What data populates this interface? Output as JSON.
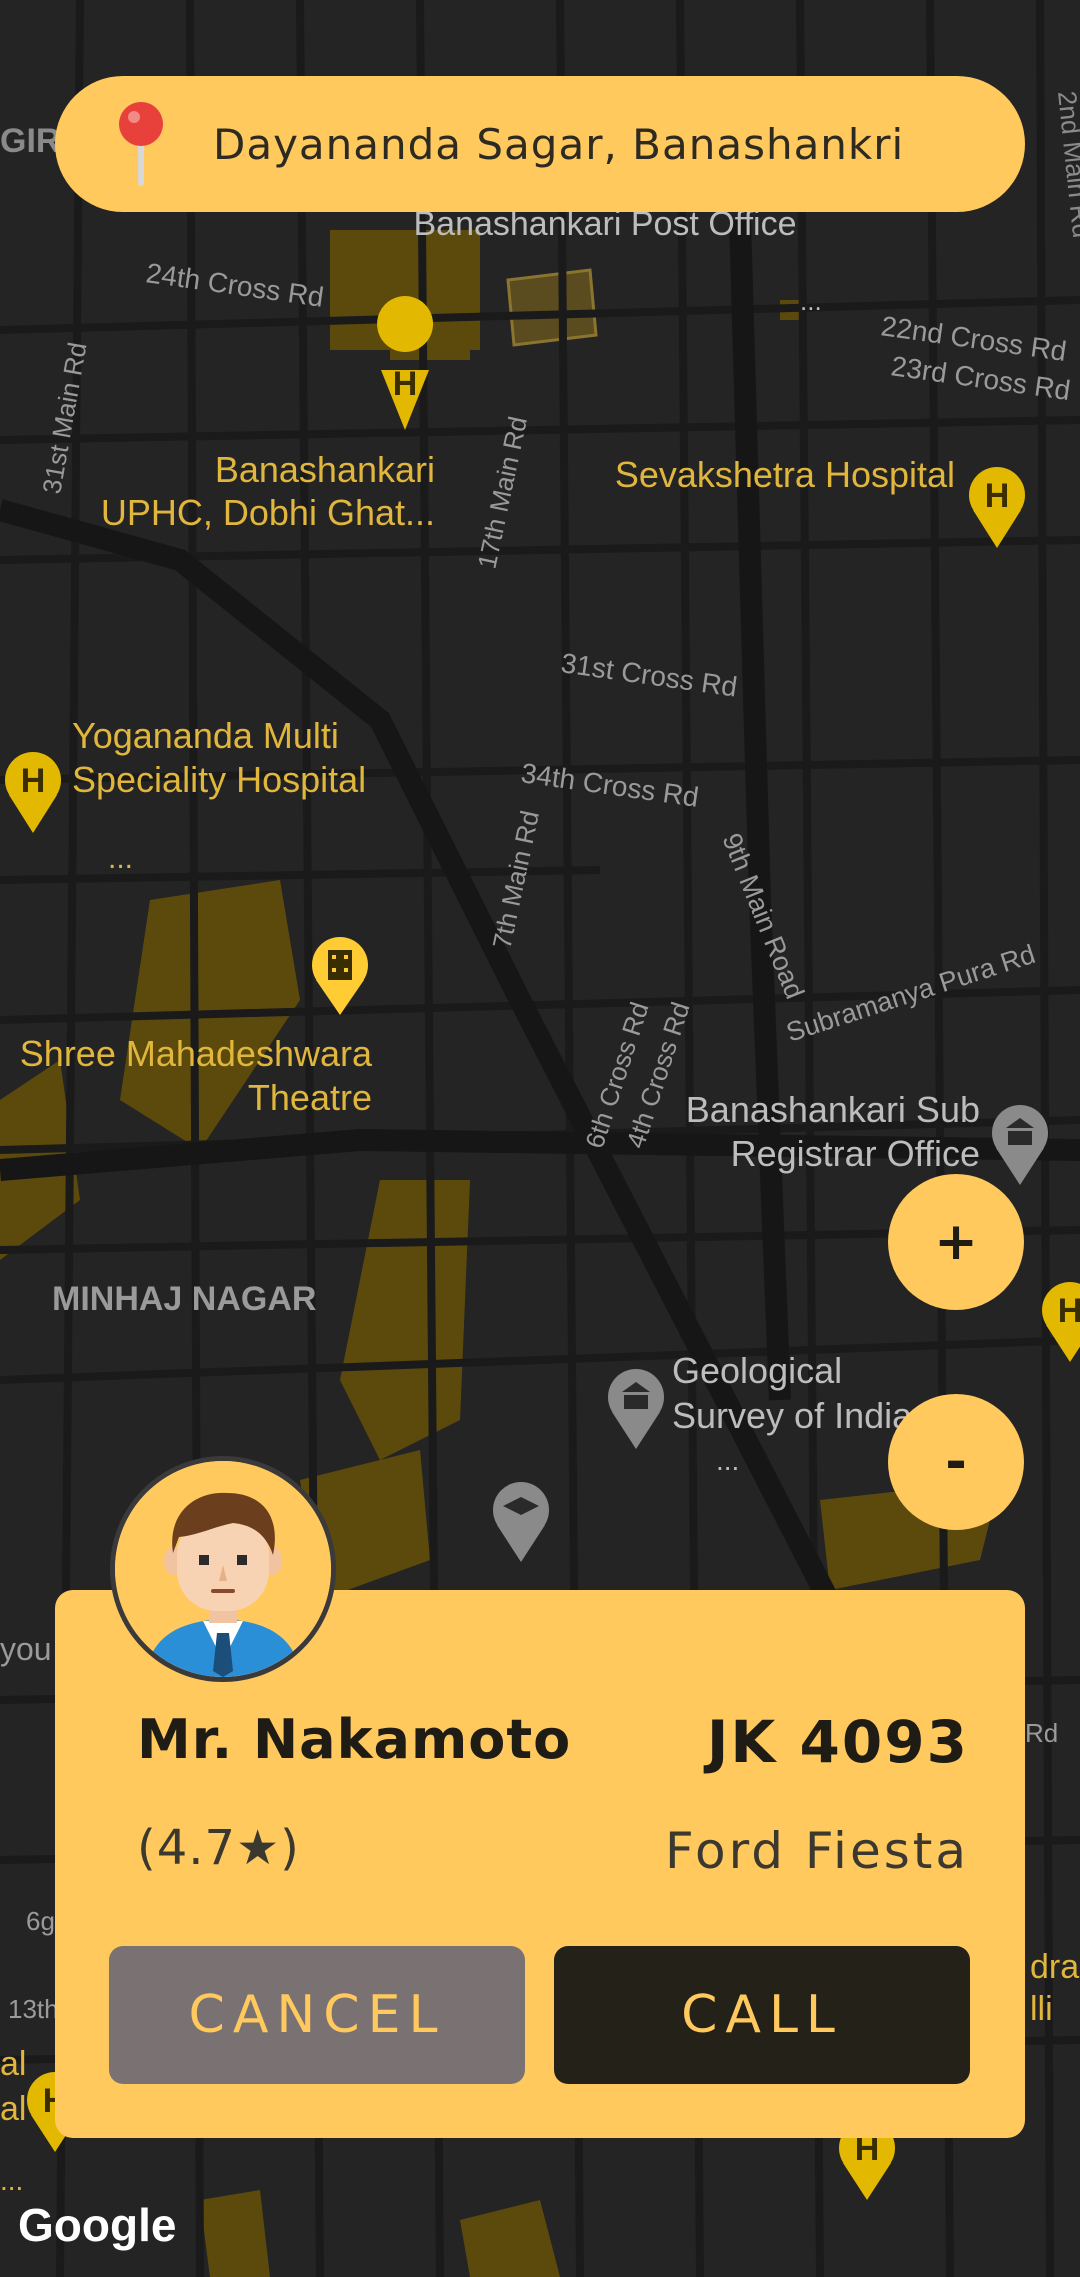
{
  "colors": {
    "accent": "#FFC95E",
    "map_bg": "#242424",
    "dark_button": "#242119",
    "cancel_button": "#7a7272"
  },
  "search": {
    "location": "Dayananda Sagar, Banashankri",
    "icon": "map-pin-icon"
  },
  "map": {
    "labels": {
      "post_office": "Banashankari Post Office",
      "cross24": "24th Cross Rd",
      "cross22": "22nd Cross Rd",
      "cross23": "23rd Cross Rd",
      "main31": "31st Main Rd",
      "main17": "17th Main Rd",
      "uphc_1": "Banashankari",
      "uphc_2": "UPHC, Dobhi Ghat...",
      "sevakshetra": "Sevakshetra Hospital",
      "cross31": "31st Cross Rd",
      "cross34": "34th Cross Rd",
      "yog_1": "Yogananda Multi",
      "yog_2": "Speciality Hospital",
      "yog_3": "...",
      "main9": "9th Main Road",
      "subra": "Subramanya Pura Rd",
      "main7": "7th Main Rd",
      "theatre_1": "Shree Mahadeshwara",
      "theatre_2": "Theatre",
      "cross6": "6th Cross Rd",
      "cross4": "4th Cross Rd",
      "subreg_1": "Banashankari Sub",
      "subreg_2": "Registrar Office",
      "minhaj": "MINHAJ NAGAR",
      "geo_1": "Geological",
      "geo_2": "Survey of India",
      "geo_3": "...",
      "gir": "GIR",
      "main2": "2nd Main Rd",
      "ellipsis1": "...",
      "you": "you",
      "rd_edge": "Rd",
      "dra": "dra,",
      "lli": "lli",
      "num6": "6g",
      "num13": "13th",
      "al1": "al",
      "al2": "al",
      "dots_left": "..."
    },
    "zoom_in": "+",
    "zoom_out": "-",
    "attribution": "Google"
  },
  "driver": {
    "name": "Mr. Nakamoto",
    "rating": "(4.7★)",
    "plate": "JK 4093",
    "car": "Ford Fiesta",
    "avatar": "driver-avatar"
  },
  "actions": {
    "cancel": "CANCEL",
    "call": "CALL"
  }
}
